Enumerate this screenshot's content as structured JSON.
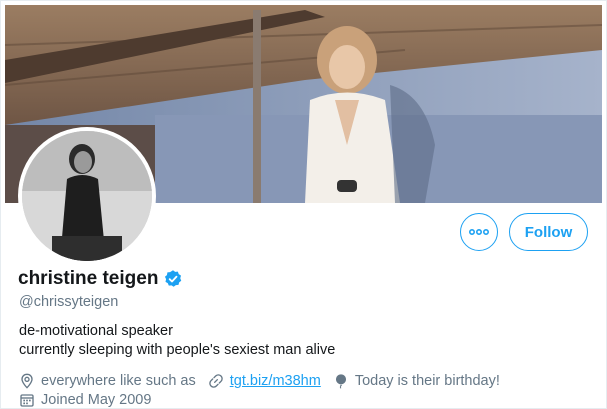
{
  "profile": {
    "display_name": "christine teigen",
    "handle": "@chrissyteigen",
    "verified": true,
    "bio_lines": [
      "de-motivational speaker",
      "currently sleeping with people's sexiest man alive"
    ],
    "location": "everywhere like such as",
    "website": "tgt.biz/m38hm",
    "birthday": "Today is their birthday!",
    "joined": "Joined May 2009"
  },
  "actions": {
    "follow_label": "Follow"
  },
  "icons": {
    "more": "more-options-icon",
    "verified": "verified-badge-icon",
    "location": "location-pin-icon",
    "link": "link-icon",
    "birthday": "balloon-icon",
    "joined": "calendar-icon"
  },
  "colors": {
    "accent": "#1da1f2",
    "text": "#14171a",
    "secondary_text": "#657786"
  }
}
